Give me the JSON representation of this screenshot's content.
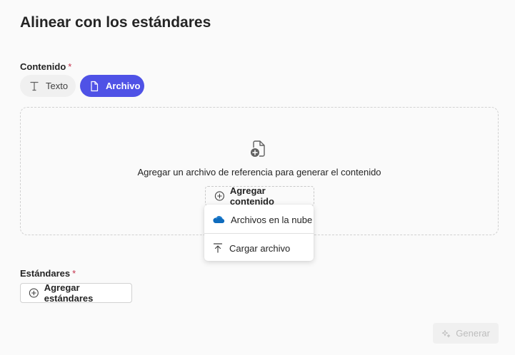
{
  "page": {
    "title": "Alinear con los estándares"
  },
  "content_field": {
    "label": "Contenido",
    "required_mark": "*",
    "options": [
      {
        "label": "Texto",
        "icon": "text-icon",
        "selected": false
      },
      {
        "label": "Archivo",
        "icon": "document-icon",
        "selected": true
      }
    ]
  },
  "dropzone": {
    "icon": "document-add-icon",
    "instruction": "Agregar un archivo de referencia para generar el contenido",
    "add_button_label": "Agregar contenido",
    "add_button_icon": "add-circle-icon"
  },
  "add_menu": {
    "items": [
      {
        "label": "Archivos en la nube",
        "icon": "cloud-icon"
      },
      {
        "label": "Cargar archivo",
        "icon": "upload-icon"
      }
    ]
  },
  "standards_field": {
    "label": "Estándares",
    "required_mark": "*",
    "add_button_label": "Agregar estándares",
    "add_button_icon": "add-circle-icon"
  },
  "footer": {
    "generate_label": "Generar",
    "generate_icon": "sparkle-icon",
    "generate_enabled": false
  },
  "colors": {
    "accent": "#4f52e6",
    "required": "#c4314b",
    "cloud": "#0f6cbd",
    "disabled_text": "#bdbdbd"
  }
}
